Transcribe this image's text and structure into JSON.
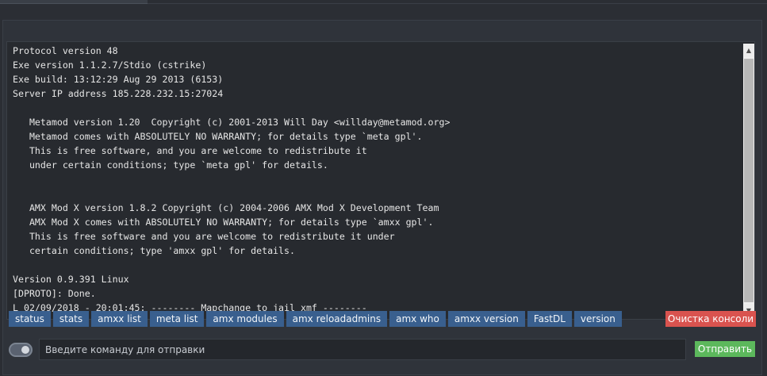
{
  "console": {
    "lines": [
      "Protocol version 48",
      "Exe version 1.1.2.7/Stdio (cstrike)",
      "Exe build: 13:12:29 Aug 29 2013 (6153)",
      "Server IP address 185.228.232.15:27024",
      "",
      "   Metamod version 1.20  Copyright (c) 2001-2013 Will Day <willday@metamod.org>",
      "   Metamod comes with ABSOLUTELY NO WARRANTY; for details type `meta gpl'.",
      "   This is free software, and you are welcome to redistribute it",
      "   under certain conditions; type `meta gpl' for details.",
      "",
      "",
      "   AMX Mod X version 1.8.2 Copyright (c) 2004-2006 AMX Mod X Development Team",
      "   AMX Mod X comes with ABSOLUTELY NO WARRANTY; for details type `amxx gpl'.",
      "   This is free software and you are welcome to redistribute it under",
      "   certain conditions; type 'amxx gpl' for details.",
      "",
      "Version 0.9.391 Linux",
      "[DPROTO]: Done.",
      "L 02/09/2018 - 20:01:45: -------- Mapchange to jail_xmf --------"
    ]
  },
  "scrollbar": {
    "up_icon": "triangle-up-icon",
    "down_icon": "triangle-down-icon"
  },
  "commands": {
    "buttons": [
      {
        "label": "status"
      },
      {
        "label": "stats"
      },
      {
        "label": "amxx list"
      },
      {
        "label": "meta list"
      },
      {
        "label": "amx modules"
      },
      {
        "label": "amx reloadadmins"
      },
      {
        "label": "amx who"
      },
      {
        "label": "amxx version"
      },
      {
        "label": "FastDL"
      },
      {
        "label": "version"
      }
    ],
    "clear_label": "Очистка консоли"
  },
  "input": {
    "placeholder": "Введите команду для отправки",
    "value": "",
    "send_label": "Отправить"
  },
  "colors": {
    "command_button": "#395f8e",
    "clear_button": "#d9534f",
    "send_button": "#5cb85c",
    "console_background": "#272a2f"
  }
}
